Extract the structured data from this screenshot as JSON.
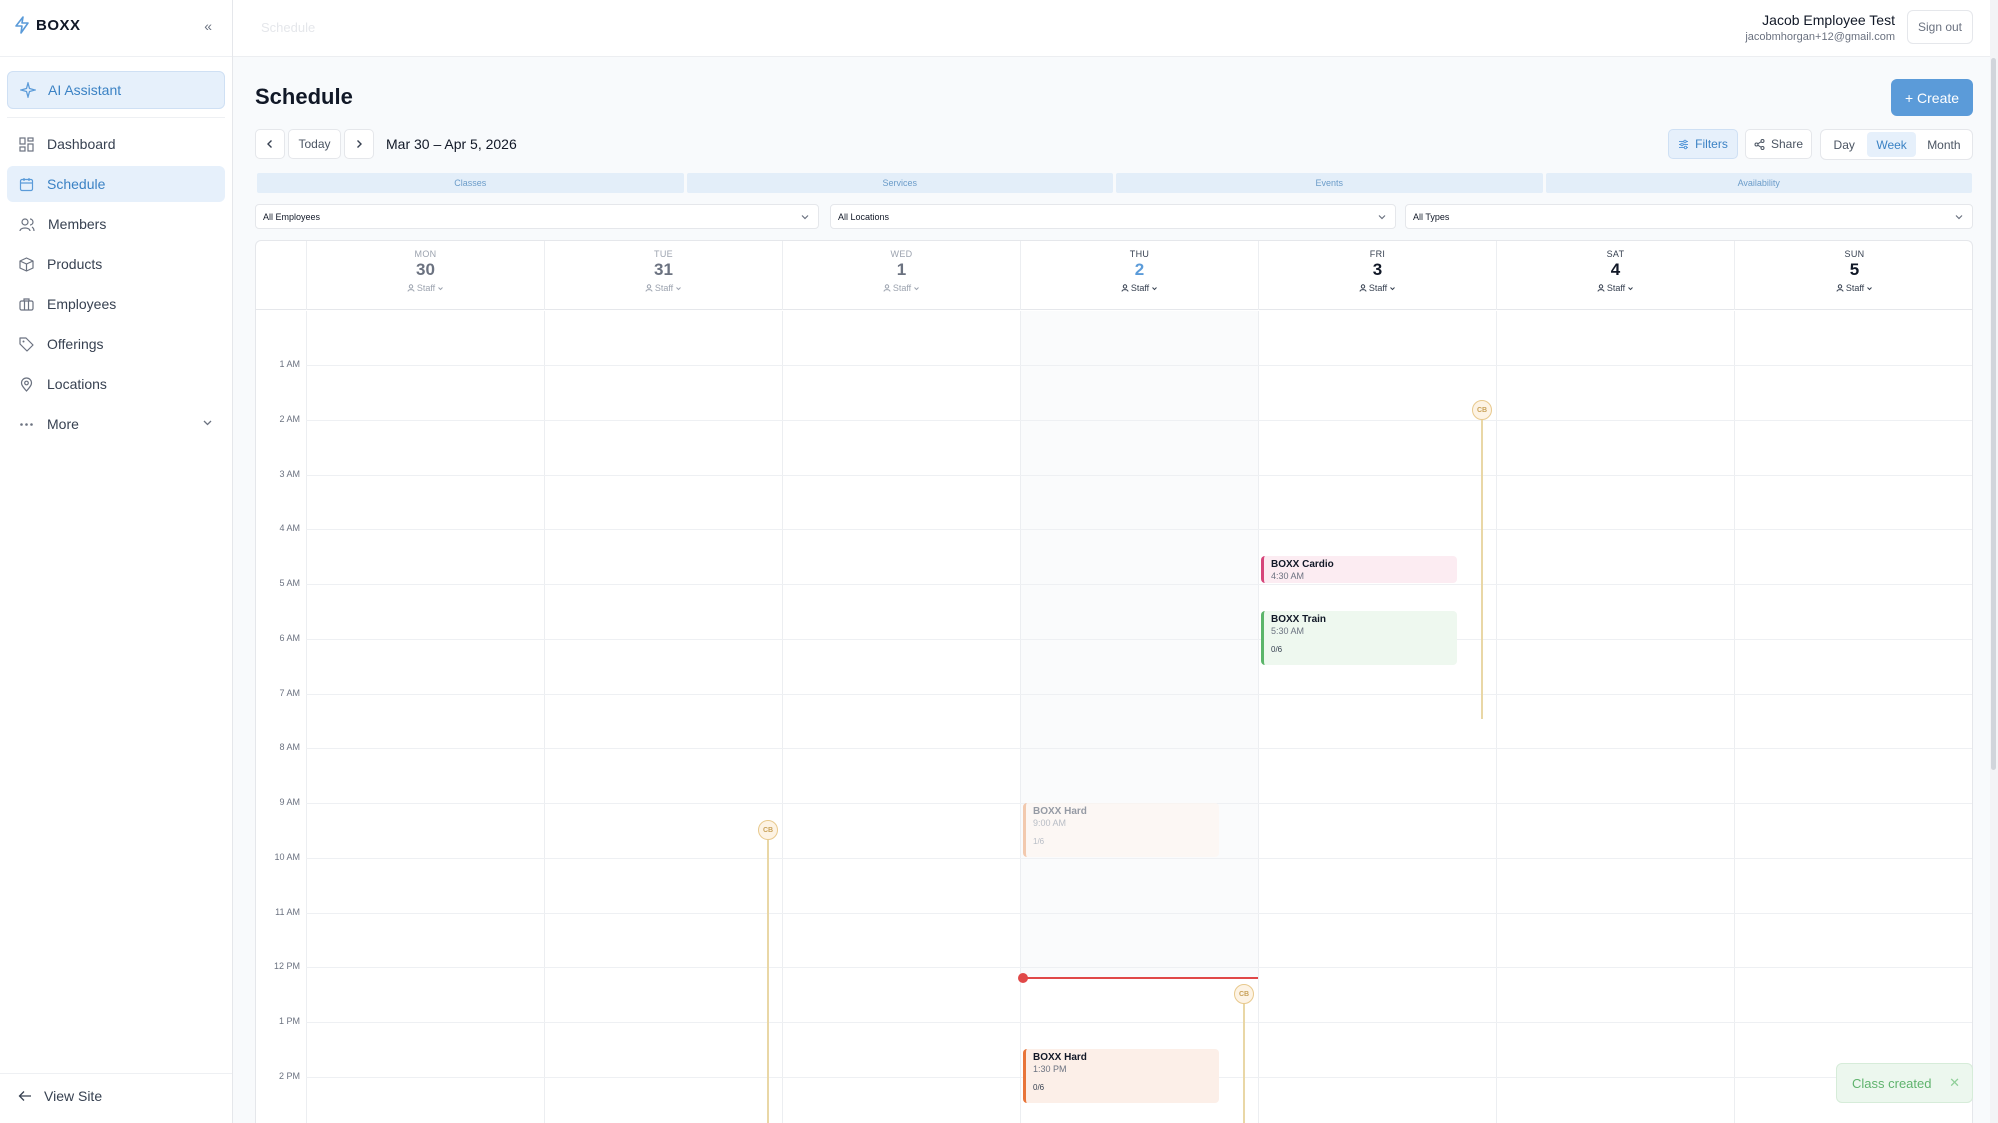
{
  "brand": {
    "name": "BOXX",
    "accent": "#5b9bd9"
  },
  "sidebar": {
    "ai_label": "AI Assistant",
    "items": [
      {
        "label": "Dashboard",
        "icon": "dashboard-icon"
      },
      {
        "label": "Schedule",
        "icon": "calendar-icon"
      },
      {
        "label": "Members",
        "icon": "users-icon"
      },
      {
        "label": "Products",
        "icon": "box-icon"
      },
      {
        "label": "Employees",
        "icon": "briefcase-icon"
      },
      {
        "label": "Offerings",
        "icon": "tag-icon"
      },
      {
        "label": "Locations",
        "icon": "map-pin-icon"
      },
      {
        "label": "More",
        "icon": "ellipsis-icon"
      }
    ],
    "view_site": "View Site"
  },
  "header": {
    "breadcrumb": "Schedule",
    "user_name": "Jacob Employee Test",
    "user_email": "jacobmhorgan+12@gmail.com",
    "sign_out": "Sign out"
  },
  "page": {
    "title": "Schedule",
    "create_label": "+ Create",
    "today_label": "Today",
    "date_range": "Mar 30 – Apr 5, 2026",
    "filters_label": "Filters",
    "share_label": "Share",
    "views": [
      "Day",
      "Week",
      "Month"
    ],
    "active_view": "Week",
    "categories": [
      "Classes",
      "Services",
      "Events",
      "Availability"
    ],
    "selects": {
      "employees": "All Employees",
      "locations": "All Locations",
      "types": "All Types"
    }
  },
  "calendar": {
    "days": [
      {
        "dow": "MON",
        "dom": "30",
        "staff": "Staff"
      },
      {
        "dow": "TUE",
        "dom": "31",
        "staff": "Staff"
      },
      {
        "dow": "WED",
        "dom": "1",
        "staff": "Staff"
      },
      {
        "dow": "THU",
        "dom": "2",
        "staff": "Staff"
      },
      {
        "dow": "FRI",
        "dom": "3",
        "staff": "Staff"
      },
      {
        "dow": "SAT",
        "dom": "4",
        "staff": "Staff"
      },
      {
        "dow": "SUN",
        "dom": "5",
        "staff": "Staff"
      }
    ],
    "hours": [
      "1 AM",
      "2 AM",
      "3 AM",
      "4 AM",
      "5 AM",
      "6 AM",
      "7 AM",
      "8 AM",
      "9 AM",
      "10 AM",
      "11 AM",
      "12 PM",
      "1 PM",
      "2 PM"
    ],
    "events": [
      {
        "title": "BOXX Cardio",
        "time": "4:30 AM",
        "capacity": "",
        "color": "#d6457a",
        "bg": "#fcecf2"
      },
      {
        "title": "BOXX Train",
        "time": "5:30 AM",
        "capacity": "0/6",
        "color": "#5bb56a",
        "bg": "#eef8ef"
      },
      {
        "title": "BOXX Hard",
        "time": "9:00 AM",
        "capacity": "1/6",
        "color": "#f0b48e",
        "bg": "#fdf6f1"
      },
      {
        "title": "BOXX Hard",
        "time": "1:30 PM",
        "capacity": "0/6",
        "color": "#e8753a",
        "bg": "#fcefe8"
      }
    ],
    "pins": [
      "CB",
      "CB",
      "CB"
    ]
  },
  "toast": {
    "message": "Class created"
  }
}
